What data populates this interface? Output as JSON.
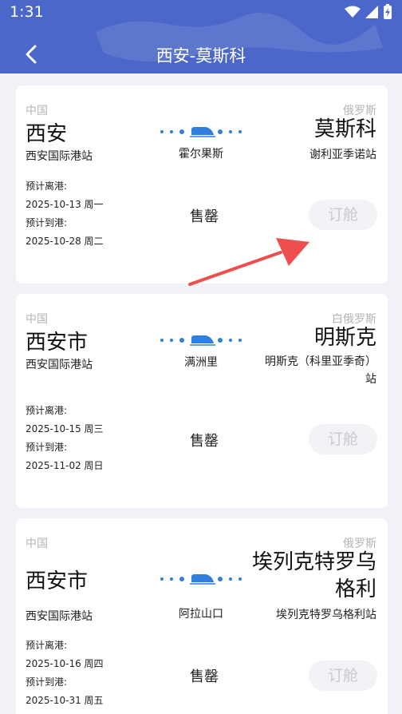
{
  "status": {
    "time": "1:31"
  },
  "nav": {
    "title": "西安-莫斯科"
  },
  "colors": {
    "header": "#4a67c9",
    "route_blue": "#2f7fe0",
    "annotation_arrow": "#ee4e4e"
  },
  "routes": [
    {
      "from_country": "中国",
      "from_city": "西安",
      "from_station": "西安国际港站",
      "to_country": "俄罗斯",
      "to_city": "莫斯科",
      "to_station": "谢利亚季诺站",
      "via": "霍尔果斯",
      "depart_label": "预计离港:",
      "depart_date": "2025-10-13 周一",
      "arrive_label": "预计到港:",
      "arrive_date": "2025-10-28 周二",
      "status": "售罄",
      "book_label": "订舱"
    },
    {
      "from_country": "中国",
      "from_city": "西安市",
      "from_station": "西安国际港站",
      "to_country": "白俄罗斯",
      "to_city": "明斯克",
      "to_station_line1": "明斯克（科里亚季奇）",
      "to_station_line2": "站",
      "via": "满洲里",
      "depart_label": "预计离港:",
      "depart_date": "2025-10-15 周三",
      "arrive_label": "预计到港:",
      "arrive_date": "2025-11-02 周日",
      "status": "售罄",
      "book_label": "订舱"
    },
    {
      "from_country": "中国",
      "from_city": "西安市",
      "from_station": "西安国际港站",
      "to_country": "俄罗斯",
      "to_city_line1": "埃列克特罗乌",
      "to_city_line2": "格利",
      "to_station": "埃列克特罗乌格利站",
      "via": "阿拉山口",
      "depart_label": "预计离港:",
      "depart_date": "2025-10-16 周四",
      "arrive_label": "预计到港:",
      "arrive_date": "2025-10-31 周五",
      "status": "售罄",
      "book_label": "订舱"
    }
  ]
}
